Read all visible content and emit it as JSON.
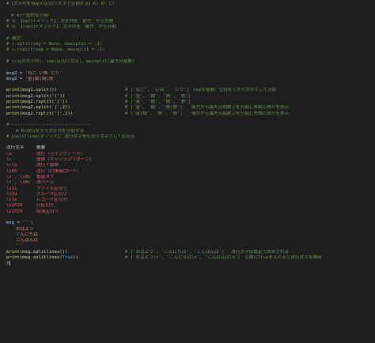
{
  "editor": {
    "l1": "#【文字列を特定の区切り文字で分割する】A) B) C)",
    "l3": "# A)一般的な分割",
    "l4": "# ① 【splitメソッド】：文字列を　前方　から分割",
    "l5": "# ② 【rsplitメソッド】：文字列を　後方　から分割",
    "l7": "# 構文：",
    "l8": "# s.split(sep = None, maxsplit = -1)",
    "l9": "# s.rsplit(sep = None, maxsplit = -1)",
    "l11": "# s(元の文字列)、sep(区切り文字)、maxsplit(最大分割数)",
    "l13_code": "msg1 = ",
    "l13_str": "'ねこ いぬ とり'",
    "l14_code": "msg2 = ",
    "l14_str": "'金|銀|銅|鉄'",
    "l16_code": "print(msg1.split())",
    "l16_cmt": "# ['ねこ', 'いぬ', 'とり']　sepを省略：空白をくぎり文字として分割",
    "l17_code": "print(msg2.split('|'))",
    "l17_cmt": "# ['金', '銀', '銅', '鉄']",
    "l18_code": "print(msg2.rsplit('|'))",
    "l18_cmt": "# ['金', '銀', '銅', '鉄']",
    "l19_code": "print(msg2.split('|',2))",
    "l19_cmt": "# ['金', '銀', '銅|鉄']　　前方から最大分割数２を分割し末尾に残りを表示",
    "l20_code": "print(msg2.rsplit('|',2))",
    "l20_cmt": "# ['金|銀', '銅', '鉄']　　後方から最大分割数２を分割し先頭に残りを表示",
    "l22": "#-------------------------------",
    "l23": "# B)改行文字で文字列を分割する",
    "l24": "#【splitlinesメソッド】：改行文字を区切り文字として区切る",
    "l26_a": "改行文字",
    "l26_b": "概要",
    "escapes": [
      {
        "code": "\\n",
        "desc": "改行（ラインフィード）"
      },
      {
        "code": "\\r",
        "desc": "復帰（キャリッジリターン）"
      },
      {
        "code": "\\r\\n",
        "desc": "改行＋復帰"
      },
      {
        "code": "\\x85",
        "desc": "改行（C1制御コード）"
      },
      {
        "code": "\\v , \\x0b",
        "desc": "垂直タブ"
      },
      {
        "code": "\\f , \\x0c",
        "desc": "改ページ"
      },
      {
        "code": "\\x1c",
        "desc": "ファイル区切り"
      },
      {
        "code": "\\x1d",
        "desc": "グループ区切り"
      },
      {
        "code": "\\x1e",
        "desc": "レコード区切り"
      },
      {
        "code": "\\u2028",
        "desc": "行区切り"
      },
      {
        "code": "\\u2029",
        "desc": "段落区切り"
      }
    ],
    "l39_code": "msg = ",
    "l39_str": "'''\\",
    "l40": "おはよう",
    "l41": "こんにちは",
    "l42": "こんばんは",
    "l43": "'''",
    "l44_code": "print(msg.splitlines())",
    "l44_cmt": "# ['おはよう', 'こんにちは', 'こんばんは']　 改行文字は既定で除去される",
    "l45_code_a": "print(msg.splitlines(",
    "l45_true": "True",
    "l45_code_b": "))",
    "l45_cmt": "# ['おはよう\\n', 'こんにちは\\n', 'こんばんは\\n']　引数にTrueを入れると改行文字を維持",
    "l46": "#"
  }
}
